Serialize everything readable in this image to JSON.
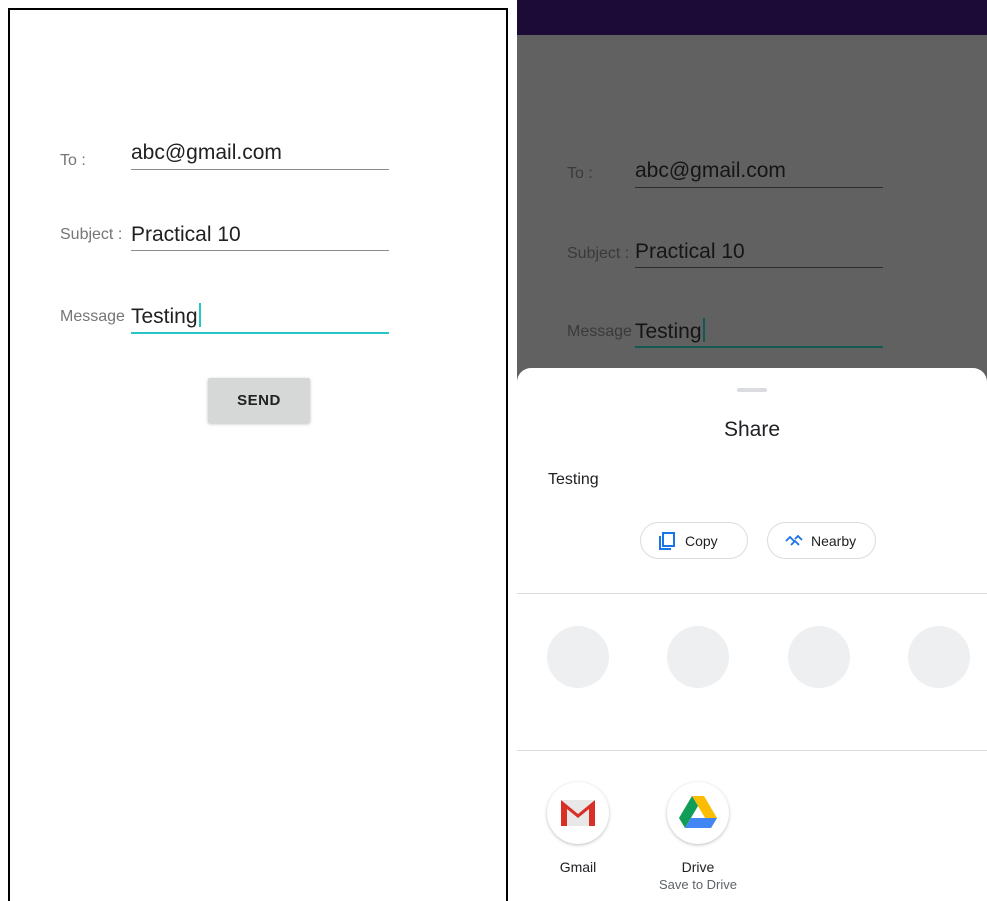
{
  "left_screen": {
    "to_label": "To :",
    "to_value": "abc@gmail.com",
    "subject_label": "Subject :",
    "subject_value": "Practical 10",
    "message_label": "Message",
    "message_value": "Testing",
    "send_label": "SEND"
  },
  "right_screen": {
    "to_label": "To :",
    "to_value": "abc@gmail.com",
    "subject_label": "Subject :",
    "subject_value": "Practical 10",
    "message_label": "Message",
    "message_value": "Testing",
    "share_sheet": {
      "title": "Share",
      "shared_text": "Testing",
      "actions": [
        {
          "label": "Copy",
          "icon": "copy-icon"
        },
        {
          "label": "Nearby",
          "icon": "nearby-icon"
        }
      ],
      "apps": [
        {
          "name": "Gmail",
          "subtitle": "",
          "icon": "gmail-icon"
        },
        {
          "name": "Drive",
          "subtitle": "Save to Drive",
          "icon": "drive-icon"
        }
      ]
    }
  },
  "colors": {
    "accent": "#26c6c6",
    "statusbar": "#1c0a37",
    "scrim": "#616161",
    "button": "#d6d7d7"
  }
}
